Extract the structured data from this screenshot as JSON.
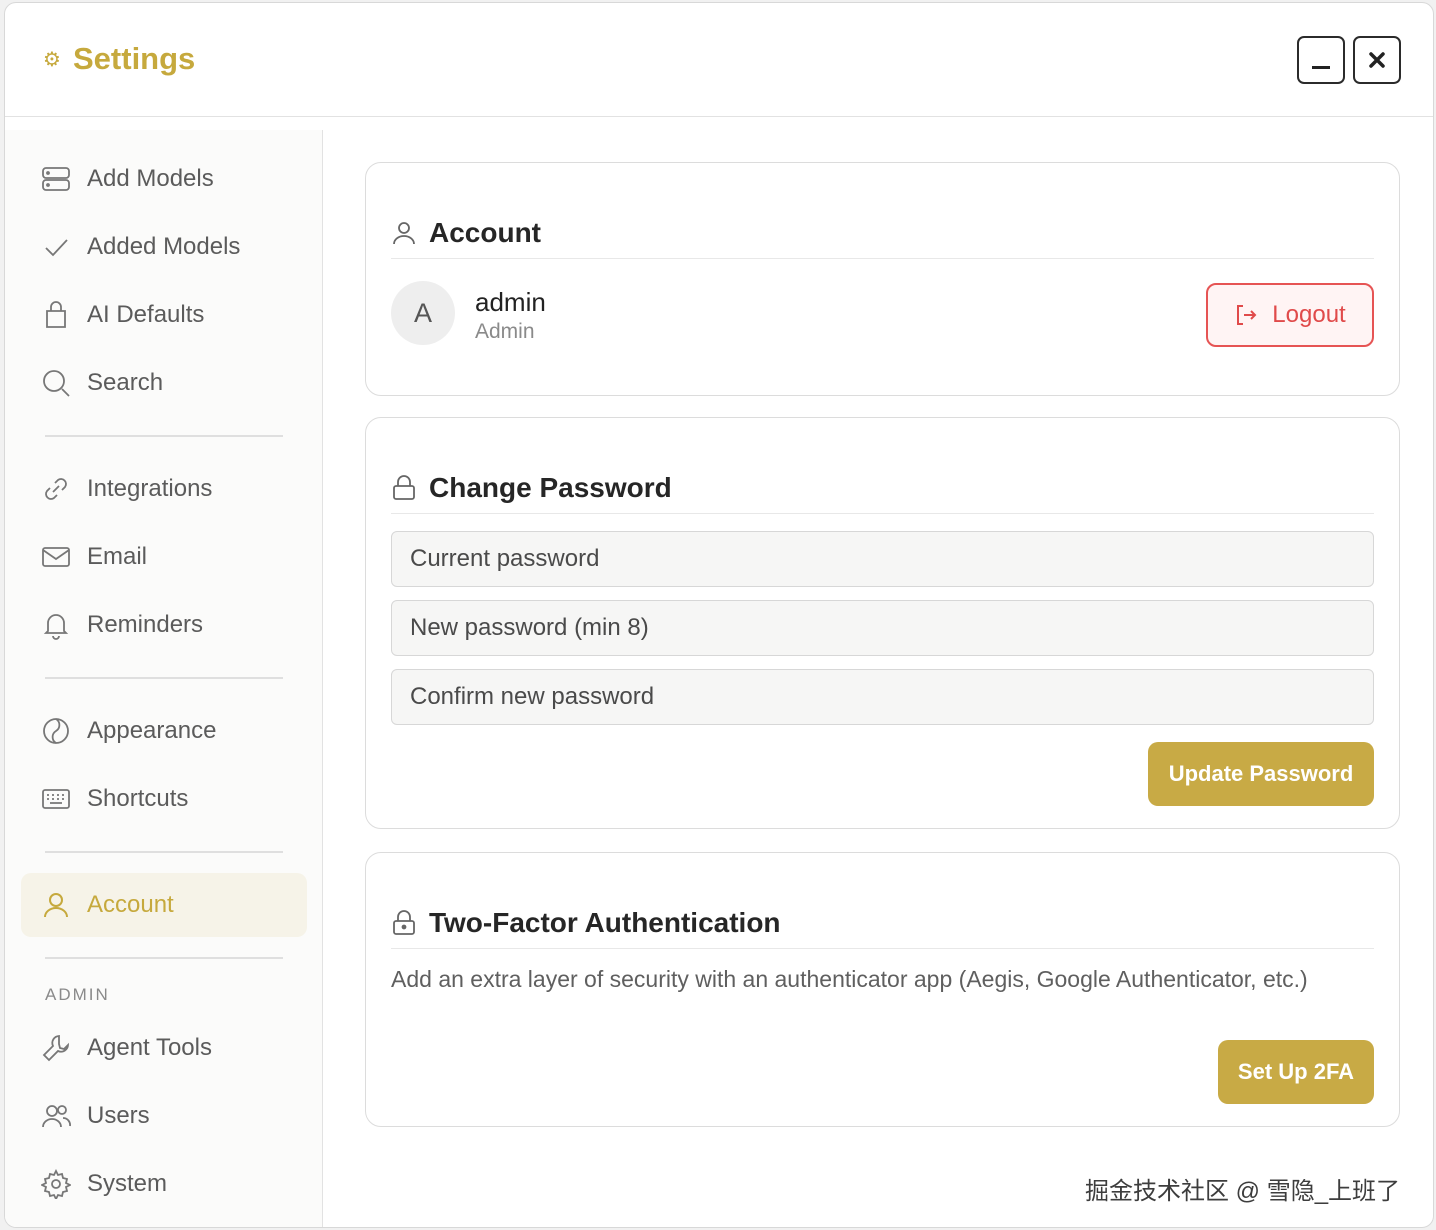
{
  "window": {
    "title": "Settings",
    "title_icon": "gear-icon",
    "accent_color": "#c6a93d",
    "minimize_icon": "minimize-icon",
    "close_icon": "close-icon"
  },
  "sidebar": {
    "items": [
      {
        "label": "Add Models",
        "icon": "server-icon"
      },
      {
        "label": "Added Models",
        "icon": "check-icon"
      },
      {
        "label": "AI Defaults",
        "icon": "bag-icon"
      },
      {
        "label": "Search",
        "icon": "search-icon"
      },
      {
        "label": "Integrations",
        "icon": "link-icon"
      },
      {
        "label": "Email",
        "icon": "mail-icon"
      },
      {
        "label": "Reminders",
        "icon": "bell-icon"
      },
      {
        "label": "Appearance",
        "icon": "palette-icon"
      },
      {
        "label": "Shortcuts",
        "icon": "keyboard-icon"
      },
      {
        "label": "Account",
        "icon": "user-icon",
        "active": true
      }
    ],
    "admin_label": "ADMIN",
    "admin_items": [
      {
        "label": "Agent Tools",
        "icon": "wrench-icon"
      },
      {
        "label": "Users",
        "icon": "users-icon"
      },
      {
        "label": "System",
        "icon": "gear-icon"
      }
    ]
  },
  "account": {
    "title": "Account",
    "avatar_initial": "A",
    "username": "admin",
    "role": "Admin",
    "logout_label": "Logout",
    "logout_color": "#e04a4a"
  },
  "change_password": {
    "title": "Change Password",
    "current_placeholder": "Current password",
    "new_placeholder": "New password (min 8)",
    "confirm_placeholder": "Confirm new password",
    "update_label": "Update Password"
  },
  "two_factor": {
    "title": "Two-Factor Authentication",
    "description": "Add an extra layer of security with an authenticator app (Aegis, Google Authenticator, etc.)",
    "setup_label": "Set Up 2FA"
  },
  "watermark": "掘金技术社区 @ 雪隐_上班了"
}
